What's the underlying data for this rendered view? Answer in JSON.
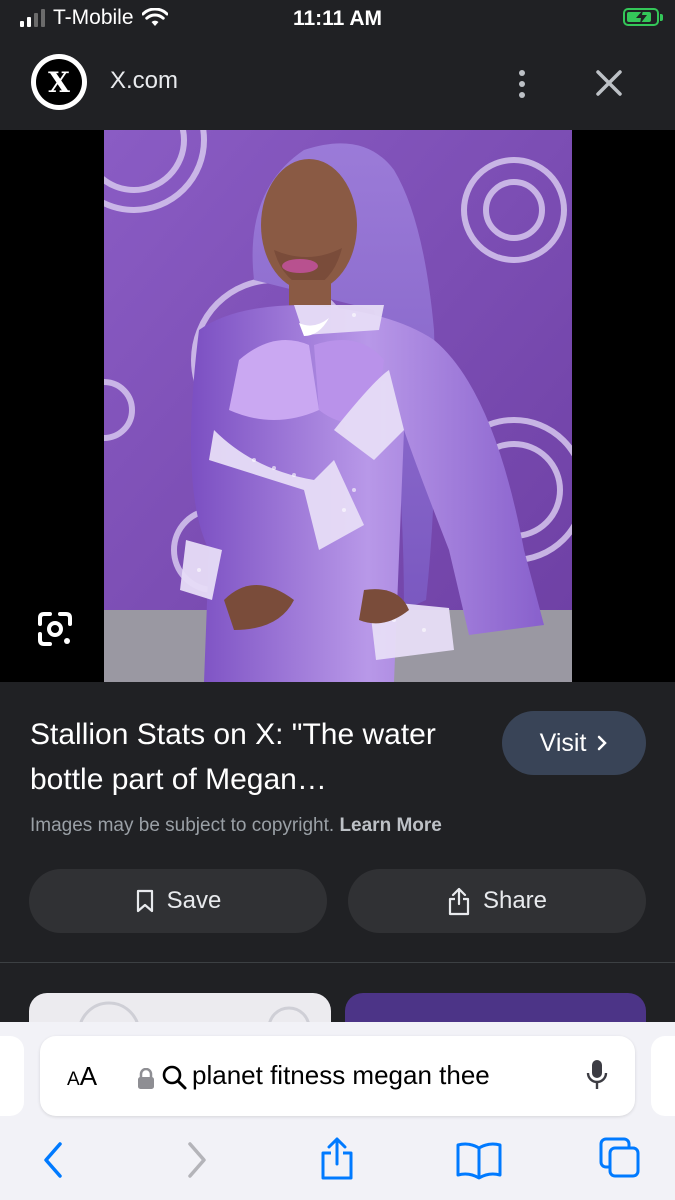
{
  "status": {
    "carrier": "T-Mobile",
    "time": "11:11 AM",
    "signal_bars_active": 2,
    "signal_bars_total": 4,
    "battery_level": 0.85,
    "battery_color": "#34c759",
    "icons": [
      "signal-icon",
      "wifi-icon",
      "battery-charging-icon"
    ]
  },
  "header": {
    "site_logo_letter": "X",
    "site_name": "X.com",
    "icons": [
      "x-logo-icon",
      "more-vert-icon",
      "close-icon"
    ]
  },
  "image": {
    "background": "#7a4fb0",
    "icons": [
      "google-lens-icon"
    ]
  },
  "result": {
    "title": "Stallion Stats on X: \"The water bottle part of Megan…",
    "visit_label": "Visit",
    "copyright_text": "Images may be subject to copyright.",
    "learn_more_label": "Learn More",
    "save_label": "Save",
    "share_label": "Share",
    "visit_color": "#394457",
    "icons": [
      "chevron-right-icon",
      "bookmark-icon",
      "share-icon"
    ]
  },
  "safari": {
    "aa_small": "A",
    "aa_large": "A",
    "query": "planet fitness megan thee",
    "icons": [
      "lock-icon",
      "search-icon",
      "microphone-icon",
      "back-icon",
      "forward-icon",
      "share-icon",
      "bookmarks-icon",
      "tabs-icon"
    ],
    "accent": "#007aff"
  }
}
